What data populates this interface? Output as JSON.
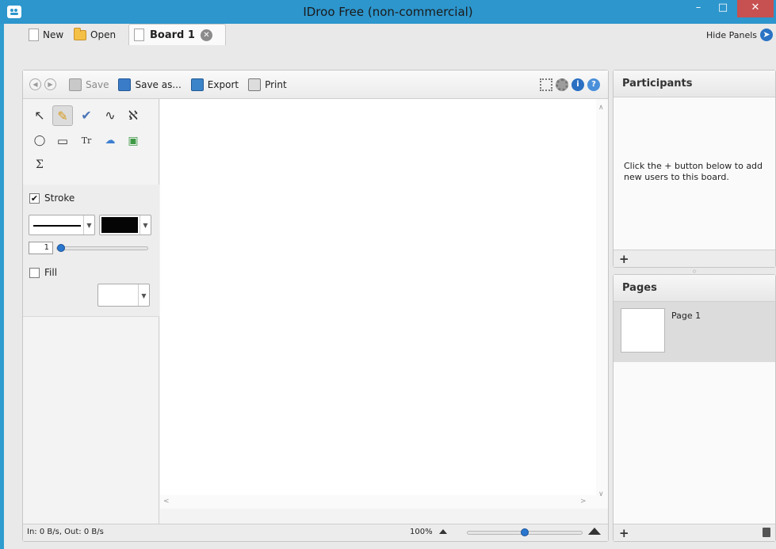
{
  "window": {
    "title": "IDroo Free (non-commercial)",
    "minimize_glyph": "–",
    "maximize_glyph": "□",
    "close_glyph": "✕"
  },
  "tabs": {
    "new_label": "New",
    "open_label": "Open",
    "board_label": "Board 1",
    "close_glyph": "✕",
    "hide_panels_label": "Hide Panels",
    "hide_panels_glyph": "➤"
  },
  "toolbar": {
    "back_glyph": "◀",
    "forward_glyph": "▶",
    "save_label": "Save",
    "save_as_label": "Save as...",
    "export_label": "Export",
    "print_label": "Print",
    "info_glyph": "i",
    "help_glyph": "?"
  },
  "tools": {
    "pointer": "↖",
    "pencil": "✎",
    "brush": "✔",
    "freehand": "∿",
    "lasso": "ℵ",
    "ellipse": "◯",
    "rectangle": "▭",
    "text": "Tr",
    "speech": "☁",
    "image": "▣",
    "formula": "Σ"
  },
  "stroke": {
    "label": "Stroke",
    "checked_glyph": "✔",
    "width_value": "1",
    "color": "#050505",
    "slider_fraction": 0.0
  },
  "fill": {
    "label": "Fill"
  },
  "status": {
    "network": "In: 0 B/s, Out: 0 B/s",
    "zoom": "100%",
    "zoom_fraction": 0.5
  },
  "scroll": {
    "up": "∧",
    "down": "∨",
    "left": "<",
    "right": ">"
  },
  "participants": {
    "title": "Participants",
    "hint": "Click the + button below to add new users to this board.",
    "add_glyph": "+"
  },
  "pages": {
    "title": "Pages",
    "items": [
      {
        "label": "Page 1"
      }
    ],
    "add_glyph": "+"
  }
}
